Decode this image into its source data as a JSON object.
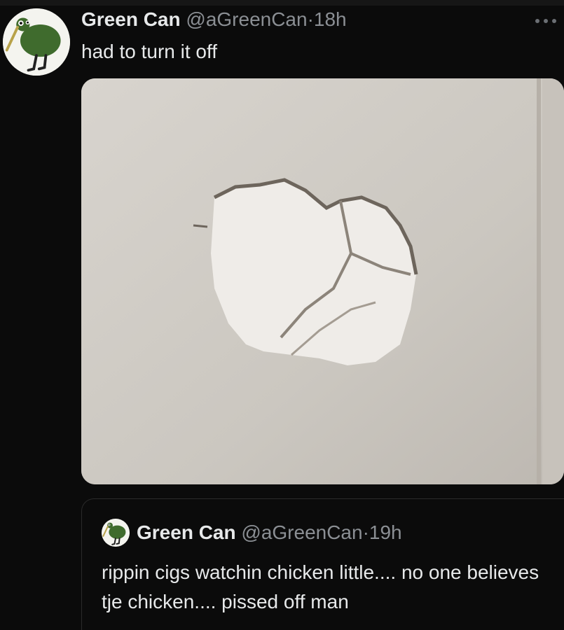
{
  "tweet": {
    "author_name": "Green Can",
    "handle": "@aGreenCan",
    "separator": "·",
    "time": "18h",
    "text": "had to turn it off",
    "avatar_icon": "kiwi-bird-icon",
    "more_icon": "more-options-icon",
    "media_description_icon": "wall-hole-photo"
  },
  "quoted_tweet": {
    "author_name": "Green Can",
    "handle": "@aGreenCan",
    "separator": "·",
    "time": "19h",
    "text": "rippin cigs watchin chicken little.... no one believes tje chicken.... pissed off man",
    "avatar_icon": "kiwi-bird-icon"
  },
  "colors": {
    "background": "#0b0b0b",
    "text_primary": "#e7e9ea",
    "text_secondary": "#8b8f94",
    "avatar_bird": "#3f6b2d",
    "wall": "#cfcbc5"
  }
}
